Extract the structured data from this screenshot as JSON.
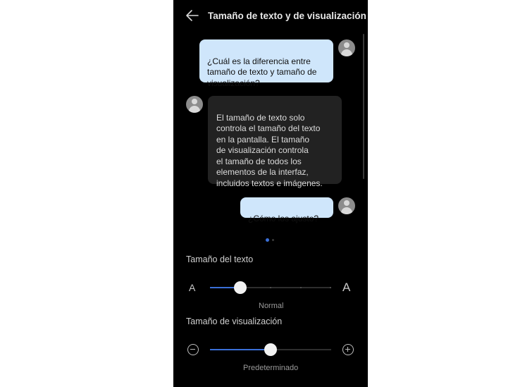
{
  "header": {
    "title": "Tamaño de texto y de visualización",
    "back_icon": "arrow-left-icon"
  },
  "chat": {
    "messages": [
      {
        "sender": "user",
        "text": "¿Cuál es la diferencia entre\ntamaño de texto y tamaño de\nvisualización?"
      },
      {
        "sender": "bot",
        "text": "El tamaño de texto solo\ncontrola el tamaño del texto\nen la pantalla. El tamaño\nde visualización controla\nel tamaño de todos los\nelementos de la interfaz,\nincluidos textos e imágenes."
      },
      {
        "sender": "user",
        "text": "¿Cómo los ajusto?"
      }
    ],
    "page_indicator": {
      "pages": 2,
      "current": 1
    }
  },
  "text_size": {
    "label": "Tamaño del texto",
    "small_glyph": "A",
    "large_glyph": "A",
    "level": 2,
    "levels": 5,
    "value_label": "Normal"
  },
  "display_size": {
    "label": "Tamaño de visualización",
    "minus_icon": "minus-circle-icon",
    "plus_icon": "plus-circle-icon",
    "fraction": 0.5,
    "value_label": "Predeterminado"
  },
  "colors": {
    "accent": "#3a6fd8",
    "user_bubble": "#cfe6fb",
    "bot_bubble": "#222222"
  }
}
